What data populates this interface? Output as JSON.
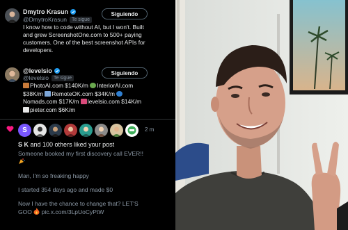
{
  "tweets": [
    {
      "name": "Dmytro Krasun",
      "handle": "@DmytroKrasun",
      "follows_badge": "Te sigue",
      "follow_button": "Siguiendo",
      "bio_lines": [
        "I know how to code without AI, but I won't. Built",
        "and grew ScreenshotOne.com to 500+ paying",
        "customers. One of the best screenshot APIs for",
        "developers."
      ]
    },
    {
      "name": "@levelsio",
      "handle": "@levelsio",
      "follows_badge": "Te sigue",
      "follow_button": "Siguiendo",
      "bio": {
        "l1a": "PhotoAI.com $140K/m",
        "l1b": "InteriorAI.com",
        "l2a": "$38K/m",
        "l2b": "RemoteOK.com $34K/m",
        "l3a": "Nomads.com $17K/m",
        "l3b": "levelsio.com $14K/m",
        "l4a": "pieter.com $6K/m"
      }
    }
  ],
  "notification": {
    "liker_initial": "S",
    "time": "2 m",
    "likes_name": "S K",
    "likes_rest": " and 100 others liked your post",
    "post_lines": [
      "Someone booked my first discovery call EVER!!",
      "Man, I'm so freaking happy",
      "I started 354 days ago and made $0",
      "Now I have the chance to change that? LET'S",
      "GOO",
      "pic.x.com/3LpUoCyPtW"
    ]
  },
  "colors": {
    "verified_blue": "#1d9bf0",
    "like_pink": "#f91880",
    "liker_purple": "#7856ff"
  }
}
